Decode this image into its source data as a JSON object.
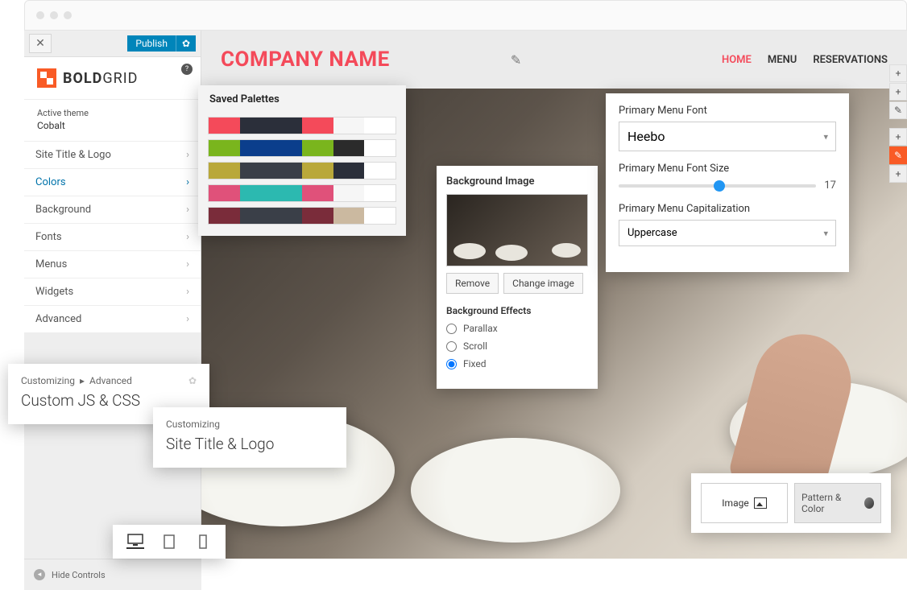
{
  "publish": {
    "label": "Publish"
  },
  "brand": {
    "bold": "BOLD",
    "grid": "GRID"
  },
  "theme": {
    "label": "Active theme",
    "name": "Cobalt"
  },
  "menu": {
    "items": [
      {
        "label": "Site Title & Logo"
      },
      {
        "label": "Colors"
      },
      {
        "label": "Background"
      },
      {
        "label": "Fonts"
      },
      {
        "label": "Menus"
      },
      {
        "label": "Widgets"
      },
      {
        "label": "Advanced"
      }
    ]
  },
  "preview": {
    "company": "COMPANY NAME",
    "nav": [
      "HOME",
      "MENU",
      "RESERVATIONS"
    ]
  },
  "palettes": {
    "title": "Saved Palettes",
    "rows": [
      [
        "#f44a5a",
        "#2b2f3a",
        "#2b2f3a",
        "#f44a5a",
        "#f6f6f6",
        "#ffffff"
      ],
      [
        "#7ab51d",
        "#0b3e8c",
        "#0b3e8c",
        "#7ab51d",
        "#2b2b2b",
        "#ffffff"
      ],
      [
        "#b9a83a",
        "#3a3f48",
        "#3a3f48",
        "#b9a83a",
        "#2b2f3a",
        "#ffffff"
      ],
      [
        "#e0517a",
        "#2cb9b0",
        "#2cb9b0",
        "#e0517a",
        "#f6f6f6",
        "#ffffff"
      ],
      [
        "#7a2c3a",
        "#3a3f48",
        "#3a3f48",
        "#7a2c3a",
        "#cbb9a0",
        "#ffffff"
      ]
    ]
  },
  "bg_panel": {
    "title": "Background Image",
    "remove": "Remove",
    "change": "Change image",
    "effects_title": "Background Effects",
    "effects": [
      "Parallax",
      "Scroll",
      "Fixed"
    ],
    "selected": "Fixed"
  },
  "font_panel": {
    "font_label": "Primary Menu Font",
    "font_value": "Heebo",
    "size_label": "Primary Menu Font Size",
    "size_value": "17",
    "cap_label": "Primary Menu Capitalization",
    "cap_value": "Uppercase"
  },
  "crumb1": {
    "a": "Customizing",
    "b": "Advanced",
    "title": "Custom JS & CSS"
  },
  "crumb2": {
    "a": "Customizing",
    "title": "Site Title & Logo"
  },
  "bg_type": {
    "image": "Image",
    "pattern": "Pattern & Color"
  },
  "bottom": {
    "hide": "Hide Controls"
  }
}
